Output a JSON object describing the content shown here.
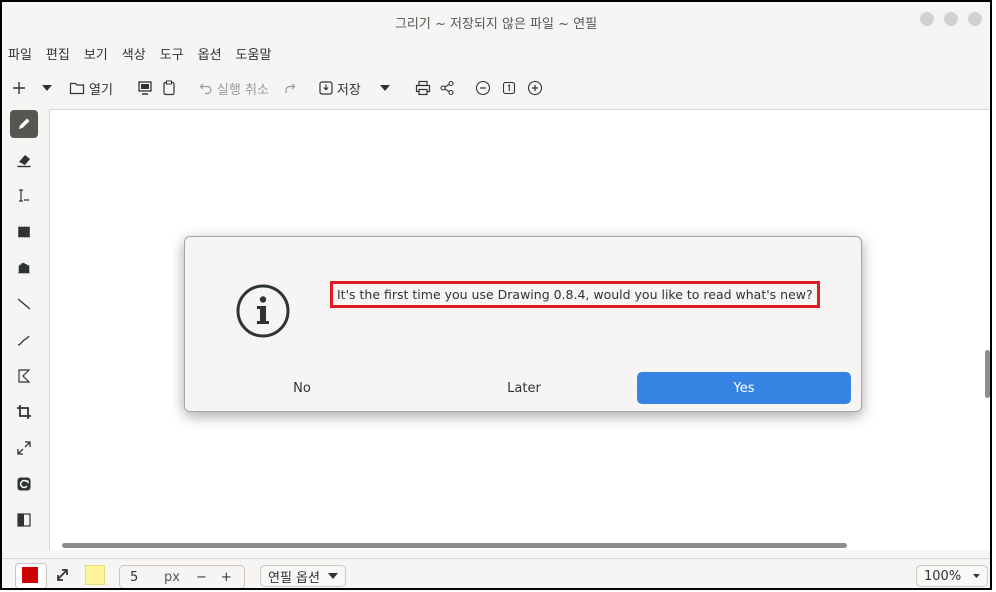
{
  "window": {
    "title": "그리기 ~ 저장되지 않은 파일 ~ 연필"
  },
  "menubar": {
    "items": [
      "파일",
      "편집",
      "보기",
      "색상",
      "도구",
      "옵션",
      "도움말"
    ]
  },
  "toolbar": {
    "open_label": "열기",
    "undo_label": "실행 취소",
    "save_label": "저장"
  },
  "tools": [
    "pencil",
    "eraser",
    "text",
    "rect-select",
    "free-select",
    "line",
    "curve",
    "polygon",
    "crop",
    "scale",
    "rotate",
    "filters"
  ],
  "colors": {
    "main": "#cc0000",
    "secondary": "#fdf59a",
    "accent": "#3584e4"
  },
  "bottombar": {
    "size_value": "5",
    "size_unit": "px",
    "minus": "−",
    "plus": "+",
    "options_label": "연필 옵션",
    "zoom_label": "100%"
  },
  "dialog": {
    "message": "It's the first time you use Drawing 0.8.4, would you like to read what's new?",
    "no_label": "No",
    "later_label": "Later",
    "yes_label": "Yes"
  }
}
